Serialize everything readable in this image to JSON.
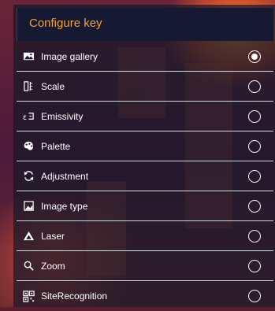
{
  "header": {
    "title": "Configure key"
  },
  "menu": {
    "items": [
      {
        "label": "Image gallery",
        "icon": "image-gallery-icon",
        "selected": true
      },
      {
        "label": "Scale",
        "icon": "scale-icon",
        "selected": false
      },
      {
        "label": "Emissivity",
        "icon": "emissivity-icon",
        "selected": false
      },
      {
        "label": "Palette",
        "icon": "palette-icon",
        "selected": false
      },
      {
        "label": "Adjustment",
        "icon": "adjustment-icon",
        "selected": false
      },
      {
        "label": "Image type",
        "icon": "image-type-icon",
        "selected": false
      },
      {
        "label": "Laser",
        "icon": "laser-icon",
        "selected": false
      },
      {
        "label": "Zoom",
        "icon": "zoom-icon",
        "selected": false
      },
      {
        "label": "SiteRecognition",
        "icon": "site-recognition-icon",
        "selected": false
      }
    ]
  },
  "background_marks": [
    "450",
    "450"
  ],
  "colors": {
    "accent": "#f2a23a",
    "header_bg": "#161932",
    "text": "#ffffff"
  }
}
